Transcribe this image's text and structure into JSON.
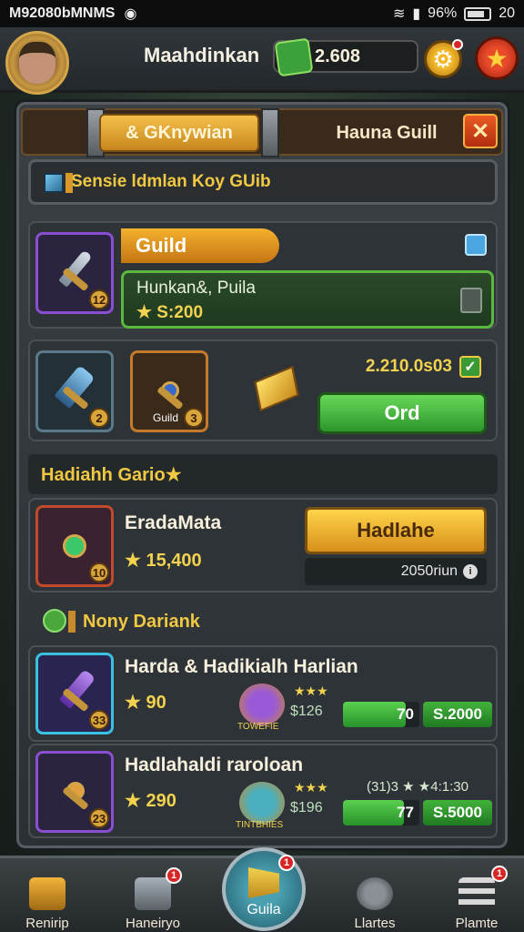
{
  "status_bar": {
    "left_text": "M92080bMNMS",
    "battery": "96%",
    "time": "20"
  },
  "header": {
    "player_name": "Maahdinkan",
    "currency": "2.608"
  },
  "tabs": {
    "active": "& GKnywian",
    "inactive": "Hauna Guill",
    "close": "✕"
  },
  "banner": {
    "text": "Sensie ldmlan Koy GUib"
  },
  "guild_card": {
    "label": "Guild",
    "name": "Hunkan&, Puila",
    "value": "★ S:200",
    "level": "12"
  },
  "trade_row": {
    "item1_level": "2",
    "item2_label": "Guild",
    "item2_level": "3",
    "value": "2.210.0s03",
    "button": "Ord"
  },
  "rewards": {
    "title": "Hadiahh Gario★",
    "item_name": "EradaMata",
    "item_value": "★ 15,400",
    "item_level": "10",
    "claim_button": "Hadlahe",
    "claim_sub": "2050riun"
  },
  "daily": {
    "title": "Nony Dariank",
    "items": [
      {
        "name": "Harda & Hadikialh Harlian",
        "value": "★ 90",
        "level": "33",
        "pet_label": "TOWEFIE",
        "stars": "★★★",
        "price_small": "$126",
        "bar_value": "70",
        "bar_fill": 0.82,
        "price": "S.2000"
      },
      {
        "name": "Hadlahaldi raroloan",
        "value": "★ 290",
        "level": "23",
        "pet_label": "TINTBHIES",
        "stars": "★★★",
        "price_small": "$196",
        "extra": "(31)3 ★ ★4:1:30",
        "bar_value": "77",
        "bar_fill": 0.8,
        "price": "S.5000"
      }
    ]
  },
  "bottom_nav": {
    "items": [
      "Renirip",
      "Haneiryo",
      "Guila",
      "Llartes",
      "Plamte"
    ],
    "badge": "1"
  },
  "colors": {
    "accent_gold": "#f2d24e",
    "accent_green": "#3ca13a",
    "accent_orange": "#e8941a",
    "panel_bg": "#2e3337"
  }
}
